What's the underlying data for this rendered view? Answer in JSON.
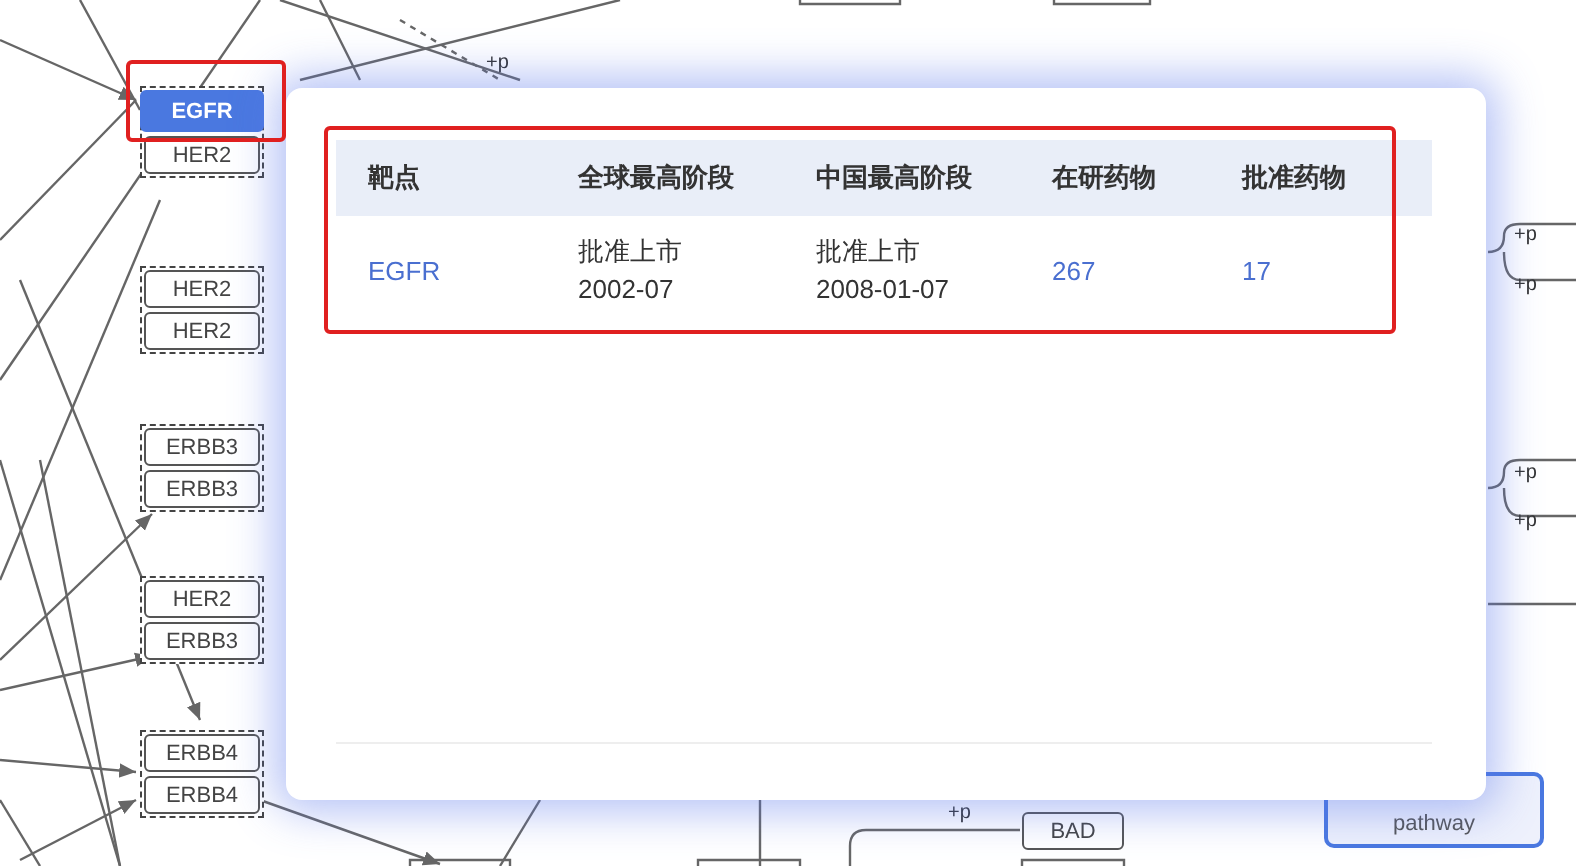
{
  "pathway": {
    "groups": [
      {
        "nodes": [
          {
            "label": "EGFR",
            "selected": true
          },
          {
            "label": "HER2",
            "selected": false
          }
        ]
      },
      {
        "nodes": [
          {
            "label": "HER2",
            "selected": false
          },
          {
            "label": "HER2",
            "selected": false
          }
        ]
      },
      {
        "nodes": [
          {
            "label": "ERBB3",
            "selected": false
          },
          {
            "label": "ERBB3",
            "selected": false
          }
        ]
      },
      {
        "nodes": [
          {
            "label": "HER2",
            "selected": false
          },
          {
            "label": "ERBB3",
            "selected": false
          }
        ]
      },
      {
        "nodes": [
          {
            "label": "ERBB4",
            "selected": false
          },
          {
            "label": "ERBB4",
            "selected": false
          }
        ]
      }
    ],
    "bad_node": {
      "label": "BAD"
    },
    "pathway_link": {
      "label": "pathway"
    },
    "phospho_labels": [
      "+p",
      "+p",
      "+p",
      "+p",
      "+p",
      "+p"
    ]
  },
  "popup": {
    "table": {
      "columns": [
        "靶点",
        "全球最高阶段",
        "中国最高阶段",
        "在研药物",
        "批准药物"
      ],
      "rows": [
        {
          "target": "EGFR",
          "global_stage": "批准上市",
          "global_date": "2002-07",
          "china_stage": "批准上市",
          "china_date": "2008-01-07",
          "in_research": "267",
          "approved": "17"
        }
      ]
    }
  }
}
